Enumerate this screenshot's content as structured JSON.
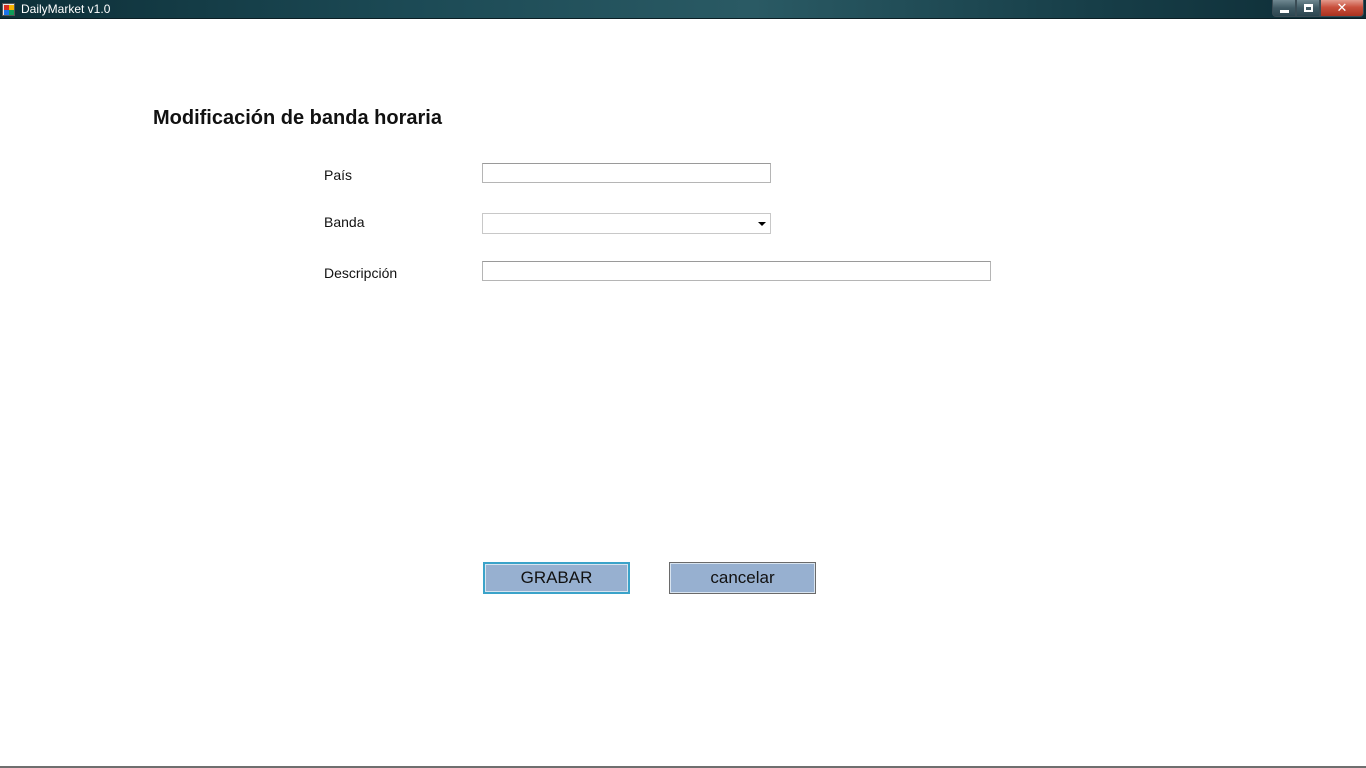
{
  "window": {
    "title": "DailyMarket v1.0",
    "controls": {
      "minimize_icon": "minimize-icon",
      "maximize_icon": "restore-icon",
      "close_symbol": "✕"
    }
  },
  "form": {
    "title": "Modificación de banda horaria",
    "fields": {
      "pais": {
        "label": "País",
        "value": ""
      },
      "banda": {
        "label": "Banda",
        "value": ""
      },
      "descripcion": {
        "label": "Descripción",
        "value": ""
      }
    }
  },
  "buttons": {
    "save_label": "GRABAR",
    "cancel_label": "cancelar"
  },
  "colors": {
    "titlebar": "#1c4a55",
    "button_bg": "#97b0d0",
    "focus_border": "#3ba3c9"
  }
}
